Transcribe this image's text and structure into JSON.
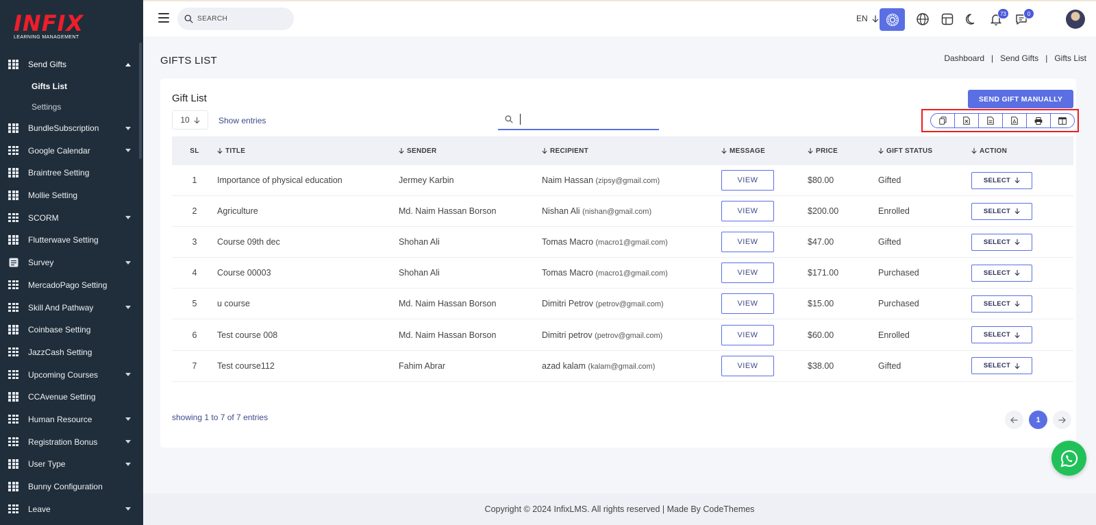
{
  "logo": {
    "text": "INFIX",
    "subtitle": "LEARNING MANAGEMENT"
  },
  "sidebar": {
    "items": [
      {
        "label": "Send Gifts",
        "open": true,
        "has_caret": true
      },
      {
        "label": "BundleSubscription",
        "has_caret": true
      },
      {
        "label": "Google Calendar",
        "has_caret": true
      },
      {
        "label": "Braintree Setting",
        "has_caret": false
      },
      {
        "label": "Mollie Setting",
        "has_caret": false
      },
      {
        "label": "SCORM",
        "has_caret": true
      },
      {
        "label": "Flutterwave Setting",
        "has_caret": false
      },
      {
        "label": "Survey",
        "has_caret": true
      },
      {
        "label": "MercadoPago Setting",
        "has_caret": false
      },
      {
        "label": "Skill And Pathway",
        "has_caret": true
      },
      {
        "label": "Coinbase Setting",
        "has_caret": false
      },
      {
        "label": "JazzCash Setting",
        "has_caret": false
      },
      {
        "label": "Upcoming Courses",
        "has_caret": true
      },
      {
        "label": "CCAvenue Setting",
        "has_caret": false
      },
      {
        "label": "Human Resource",
        "has_caret": true
      },
      {
        "label": "Registration Bonus",
        "has_caret": true
      },
      {
        "label": "User Type",
        "has_caret": true
      },
      {
        "label": "Bunny Configuration",
        "has_caret": false
      },
      {
        "label": "Leave",
        "has_caret": true
      }
    ],
    "sub_items": [
      {
        "label": "Gifts List",
        "active": true
      },
      {
        "label": "Settings",
        "active": false
      }
    ]
  },
  "topbar": {
    "search_placeholder": "SEARCH",
    "language": "EN",
    "notifications_count": "73",
    "messages_count": "0"
  },
  "page": {
    "title": "GIFTS LIST",
    "breadcrumb": [
      "Dashboard",
      "Send Gifts",
      "Gifts List"
    ]
  },
  "card": {
    "title": "Gift List",
    "send_gift_button": "SEND GIFT MANUALLY",
    "entries_value": "10",
    "show_entries_label": "Show entries",
    "search_value": ""
  },
  "table": {
    "headers": {
      "sl": "SL",
      "title": "TITLE",
      "sender": "SENDER",
      "recipient": "RECIPIENT",
      "message": "MESSAGE",
      "price": "PRICE",
      "status": "GIFT STATUS",
      "action": "ACTION"
    },
    "view_label": "VIEW",
    "select_label": "SELECT",
    "rows": [
      {
        "sl": "1",
        "title": "Importance of physical education",
        "sender": "Jermey Karbin",
        "recipient": "Naim Hassan",
        "email": "(zipsy@gmail.com)",
        "price": "$80.00",
        "status": "Gifted"
      },
      {
        "sl": "2",
        "title": "Agriculture",
        "sender": "Md. Naim Hassan Borson",
        "recipient": "Nishan Ali",
        "email": "(nishan@gmail.com)",
        "price": "$200.00",
        "status": "Enrolled"
      },
      {
        "sl": "3",
        "title": "Course 09th dec",
        "sender": "Shohan Ali",
        "recipient": "Tomas Macro",
        "email": "(macro1@gmail.com)",
        "price": "$47.00",
        "status": "Gifted"
      },
      {
        "sl": "4",
        "title": "Course 00003",
        "sender": "Shohan Ali",
        "recipient": "Tomas Macro",
        "email": "(macro1@gmail.com)",
        "price": "$171.00",
        "status": "Purchased"
      },
      {
        "sl": "5",
        "title": "u course",
        "sender": "Md. Naim Hassan Borson",
        "recipient": "Dimitri Petrov",
        "email": "(petrov@gmail.com)",
        "price": "$15.00",
        "status": "Purchased"
      },
      {
        "sl": "6",
        "title": "Test course 008",
        "sender": "Md. Naim Hassan Borson",
        "recipient": "Dimitri petrov",
        "email": "(petrov@gmail.com)",
        "price": "$60.00",
        "status": "Enrolled"
      },
      {
        "sl": "7",
        "title": "Test course112",
        "sender": "Fahim Abrar",
        "recipient": "azad kalam",
        "email": "(kalam@gmail.com)",
        "price": "$38.00",
        "status": "Gifted"
      }
    ]
  },
  "pagination": {
    "showing_text": "showing 1 to 7 of 7 entries",
    "current_page": "1"
  },
  "footer": {
    "text": "Copyright © 2024 InfixLMS. All rights reserved | Made By CodeThemes"
  },
  "colors": {
    "sidebar_bg": "#202e3b",
    "accent": "#5a6fe3",
    "logo_red": "#ee1e2a",
    "highlight_red": "#ee1c1c",
    "whatsapp_green": "#21c15a"
  }
}
